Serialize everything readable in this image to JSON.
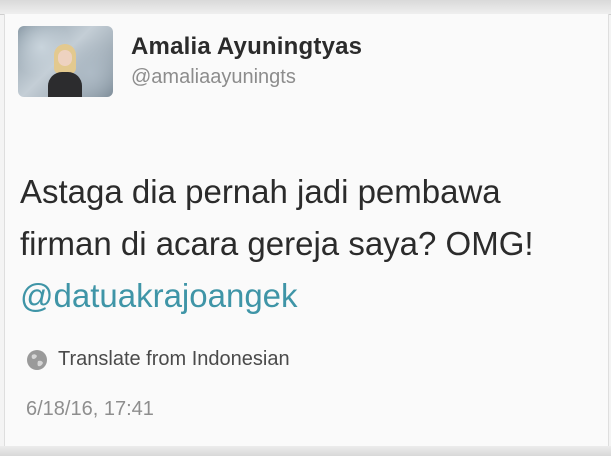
{
  "author": {
    "display_name": "Amalia Ayuningtyas",
    "handle": "@amaliaayuningts"
  },
  "tweet": {
    "line1": "Astaga dia pernah jadi pembawa",
    "line2": "firman di acara gereja saya? OMG!",
    "mention": "@datuakrajoangek"
  },
  "translate": {
    "icon": "globe-icon",
    "label": "Translate from Indonesian"
  },
  "timestamp": "6/18/16, 17:41",
  "colors": {
    "mention": "#3f95a7",
    "handle": "#8c8c8c",
    "text": "#2b2b2b"
  }
}
